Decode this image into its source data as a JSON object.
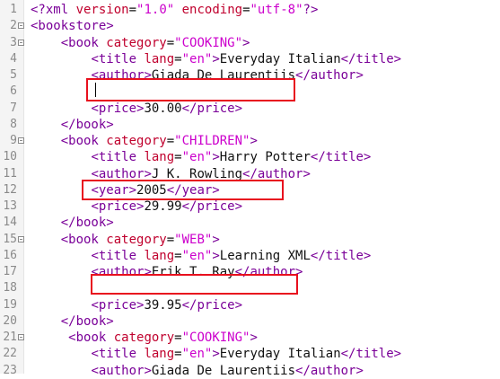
{
  "colors": {
    "tag": "#7a0098",
    "attribute": "#c0002d",
    "value": "#cc00cc",
    "text": "#111111",
    "highlight_box": "#e8101e"
  },
  "lines": [
    {
      "n": "1",
      "fold": false,
      "tokens": [
        {
          "c": "t",
          "s": "<?xml "
        },
        {
          "c": "a",
          "s": "version"
        },
        {
          "c": "x",
          "s": "="
        },
        {
          "c": "v",
          "s": "\"1.0\""
        },
        {
          "c": "x",
          "s": " "
        },
        {
          "c": "a",
          "s": "encoding"
        },
        {
          "c": "x",
          "s": "="
        },
        {
          "c": "v",
          "s": "\"utf-8\""
        },
        {
          "c": "t",
          "s": "?>"
        }
      ]
    },
    {
      "n": "2",
      "fold": true,
      "tokens": [
        {
          "c": "t",
          "s": "<bookstore>"
        }
      ]
    },
    {
      "n": "3",
      "fold": true,
      "tokens": [
        {
          "c": "x",
          "s": "    "
        },
        {
          "c": "t",
          "s": "<book "
        },
        {
          "c": "a",
          "s": "category"
        },
        {
          "c": "x",
          "s": "="
        },
        {
          "c": "v",
          "s": "\"COOKING\""
        },
        {
          "c": "t",
          "s": ">"
        }
      ]
    },
    {
      "n": "4",
      "fold": false,
      "tokens": [
        {
          "c": "x",
          "s": "        "
        },
        {
          "c": "t",
          "s": "<title "
        },
        {
          "c": "a",
          "s": "lang"
        },
        {
          "c": "x",
          "s": "="
        },
        {
          "c": "v",
          "s": "\"en\""
        },
        {
          "c": "t",
          "s": ">"
        },
        {
          "c": "x",
          "s": "Everyday Italian"
        },
        {
          "c": "t",
          "s": "</title>"
        }
      ]
    },
    {
      "n": "5",
      "fold": false,
      "tokens": [
        {
          "c": "x",
          "s": "        "
        },
        {
          "c": "t",
          "s": "<author>"
        },
        {
          "c": "x",
          "s": "Giada De Laurentiis"
        },
        {
          "c": "t",
          "s": "</author>"
        }
      ]
    },
    {
      "n": "6",
      "fold": false,
      "tokens": []
    },
    {
      "n": "7",
      "fold": false,
      "tokens": [
        {
          "c": "x",
          "s": "        "
        },
        {
          "c": "t",
          "s": "<price>"
        },
        {
          "c": "x",
          "s": "30.00"
        },
        {
          "c": "t",
          "s": "</price>"
        }
      ]
    },
    {
      "n": "8",
      "fold": false,
      "tokens": [
        {
          "c": "x",
          "s": "    "
        },
        {
          "c": "t",
          "s": "</book>"
        }
      ]
    },
    {
      "n": "9",
      "fold": true,
      "tokens": [
        {
          "c": "x",
          "s": "    "
        },
        {
          "c": "t",
          "s": "<book "
        },
        {
          "c": "a",
          "s": "category"
        },
        {
          "c": "x",
          "s": "="
        },
        {
          "c": "v",
          "s": "\"CHILDREN\""
        },
        {
          "c": "t",
          "s": ">"
        }
      ]
    },
    {
      "n": "10",
      "fold": false,
      "tokens": [
        {
          "c": "x",
          "s": "        "
        },
        {
          "c": "t",
          "s": "<title "
        },
        {
          "c": "a",
          "s": "lang"
        },
        {
          "c": "x",
          "s": "="
        },
        {
          "c": "v",
          "s": "\"en\""
        },
        {
          "c": "t",
          "s": ">"
        },
        {
          "c": "x",
          "s": "Harry Potter"
        },
        {
          "c": "t",
          "s": "</title>"
        }
      ]
    },
    {
      "n": "11",
      "fold": false,
      "tokens": [
        {
          "c": "x",
          "s": "        "
        },
        {
          "c": "t",
          "s": "<author>"
        },
        {
          "c": "x",
          "s": "J K. Rowling"
        },
        {
          "c": "t",
          "s": "</author>"
        }
      ]
    },
    {
      "n": "12",
      "fold": false,
      "tokens": [
        {
          "c": "x",
          "s": "        "
        },
        {
          "c": "t",
          "s": "<year>"
        },
        {
          "c": "x",
          "s": "2005"
        },
        {
          "c": "t",
          "s": "</year>"
        }
      ]
    },
    {
      "n": "13",
      "fold": false,
      "tokens": [
        {
          "c": "x",
          "s": "        "
        },
        {
          "c": "t",
          "s": "<price>"
        },
        {
          "c": "x",
          "s": "29.99"
        },
        {
          "c": "t",
          "s": "</price>"
        }
      ]
    },
    {
      "n": "14",
      "fold": false,
      "tokens": [
        {
          "c": "x",
          "s": "    "
        },
        {
          "c": "t",
          "s": "</book>"
        }
      ]
    },
    {
      "n": "15",
      "fold": true,
      "tokens": [
        {
          "c": "x",
          "s": "    "
        },
        {
          "c": "t",
          "s": "<book "
        },
        {
          "c": "a",
          "s": "category"
        },
        {
          "c": "x",
          "s": "="
        },
        {
          "c": "v",
          "s": "\"WEB\""
        },
        {
          "c": "t",
          "s": ">"
        }
      ]
    },
    {
      "n": "16",
      "fold": false,
      "tokens": [
        {
          "c": "x",
          "s": "        "
        },
        {
          "c": "t",
          "s": "<title "
        },
        {
          "c": "a",
          "s": "lang"
        },
        {
          "c": "x",
          "s": "="
        },
        {
          "c": "v",
          "s": "\"en\""
        },
        {
          "c": "t",
          "s": ">"
        },
        {
          "c": "x",
          "s": "Learning XML"
        },
        {
          "c": "t",
          "s": "</title>"
        }
      ]
    },
    {
      "n": "17",
      "fold": false,
      "tokens": [
        {
          "c": "x",
          "s": "        "
        },
        {
          "c": "t",
          "s": "<author>"
        },
        {
          "c": "x",
          "s": "Erik T. Ray"
        },
        {
          "c": "t",
          "s": "</author>"
        }
      ]
    },
    {
      "n": "18",
      "fold": false,
      "tokens": []
    },
    {
      "n": "19",
      "fold": false,
      "tokens": [
        {
          "c": "x",
          "s": "        "
        },
        {
          "c": "t",
          "s": "<price>"
        },
        {
          "c": "x",
          "s": "39.95"
        },
        {
          "c": "t",
          "s": "</price>"
        }
      ]
    },
    {
      "n": "20",
      "fold": false,
      "tokens": [
        {
          "c": "x",
          "s": "    "
        },
        {
          "c": "t",
          "s": "</book>"
        }
      ]
    },
    {
      "n": "21",
      "fold": true,
      "tokens": [
        {
          "c": "x",
          "s": "     "
        },
        {
          "c": "t",
          "s": "<book "
        },
        {
          "c": "a",
          "s": "category"
        },
        {
          "c": "x",
          "s": "="
        },
        {
          "c": "v",
          "s": "\"COOKING\""
        },
        {
          "c": "t",
          "s": ">"
        }
      ]
    },
    {
      "n": "22",
      "fold": false,
      "tokens": [
        {
          "c": "x",
          "s": "        "
        },
        {
          "c": "t",
          "s": "<title "
        },
        {
          "c": "a",
          "s": "lang"
        },
        {
          "c": "x",
          "s": "="
        },
        {
          "c": "v",
          "s": "\"en\""
        },
        {
          "c": "t",
          "s": ">"
        },
        {
          "c": "x",
          "s": "Everyday Italian"
        },
        {
          "c": "t",
          "s": "</title>"
        }
      ]
    },
    {
      "n": "23",
      "fold": false,
      "tokens": [
        {
          "c": "x",
          "s": "        "
        },
        {
          "c": "t",
          "s": "<author>"
        },
        {
          "c": "x",
          "s": "Giada De Laurentiis"
        },
        {
          "c": "t",
          "s": "</author>"
        }
      ]
    }
  ]
}
